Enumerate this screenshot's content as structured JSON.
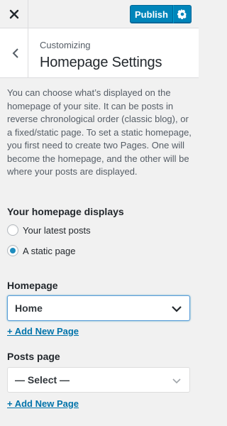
{
  "header": {
    "publish_label": "Publish",
    "close_icon": "close-icon",
    "gear_icon": "gear-icon"
  },
  "section": {
    "breadcrumb": "Customizing",
    "title": "Homepage Settings",
    "back_icon": "chevron-left-icon"
  },
  "description": "You can choose what’s displayed on the homepage of your site. It can be posts in reverse chronological order (classic blog), or a fixed/static page. To set a static homepage, you first need to create two Pages. One will become the homepage, and the other will be where your posts are displayed.",
  "homepage_displays": {
    "title": "Your homepage displays",
    "options": [
      {
        "label": "Your latest posts",
        "selected": false
      },
      {
        "label": "A static page",
        "selected": true
      }
    ]
  },
  "homepage": {
    "label": "Homepage",
    "value": "Home",
    "add_link": "+ Add New Page"
  },
  "posts_page": {
    "label": "Posts page",
    "value": "— Select —",
    "add_link": "+ Add New Page"
  },
  "colors": {
    "accent": "#0085ba",
    "link": "#0073aa",
    "background": "#f1f1f1"
  }
}
